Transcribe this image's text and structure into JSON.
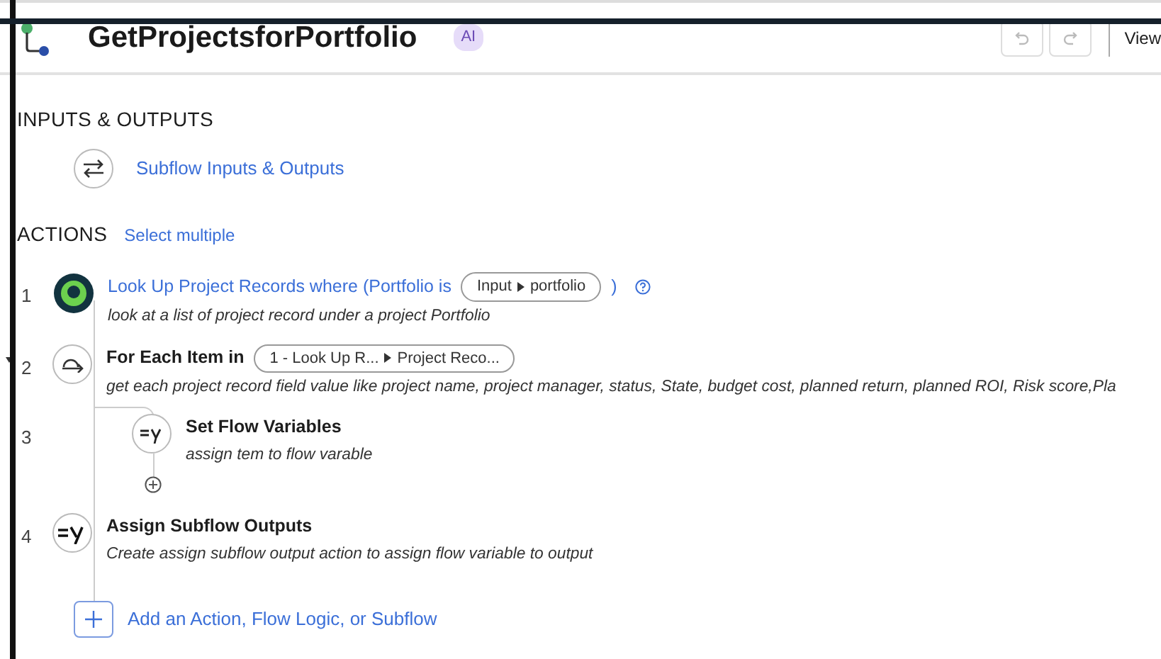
{
  "header": {
    "title": "GetProjectsforPortfolio",
    "badge": "AI",
    "view_label": "View"
  },
  "inputs_outputs": {
    "heading": "INPUTS & OUTPUTS",
    "link": "Subflow Inputs & Outputs"
  },
  "actions": {
    "heading": "ACTIONS",
    "select_link": "Select multiple",
    "steps": [
      {
        "number": "1",
        "kind": "lookup",
        "title": "Look Up Project Records where (Portfolio is",
        "pill": [
          "Input",
          "portfolio"
        ],
        "title_end": ")",
        "help": true,
        "description": "look at a list of project record under a project Portfolio"
      },
      {
        "number": "2",
        "kind": "foreach",
        "title": "For Each Item in",
        "pill": [
          "1 - Look Up R...",
          "Project Reco..."
        ],
        "collapsible": true,
        "description": "get each project record field value like project name, project manager, status, State, budget cost, planned return, planned ROI, Risk score,Pla",
        "children": [
          {
            "number": "3",
            "kind": "set",
            "title": "Set Flow Variables",
            "description": "assign tem to flow varable"
          }
        ]
      },
      {
        "number": "4",
        "kind": "assign",
        "title": "Assign Subflow Outputs",
        "description": "Create assign subflow output action to assign flow variable to output"
      }
    ],
    "add_label": "Add an Action, Flow Logic, or Subflow"
  }
}
